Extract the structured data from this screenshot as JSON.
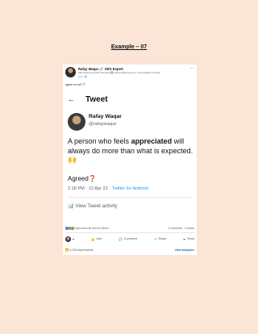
{
  "heading": "Example – 07",
  "post": {
    "author": "Rafay Waqar",
    "role": "SEO Expert",
    "headline": "SEO Expert and PPC Specialist ✅ Helping Businesses to Grow Digitally Through...",
    "time": "1mo · 🌐",
    "caption": "agree or not?",
    "reactions_count": "Syed Anas Ali and 60 others",
    "comments": "9 comments · 4 shares",
    "impressions": "4,218 impressions",
    "analytics_label": "View analytics",
    "actions": [
      "Like",
      "Comment",
      "Share",
      "Send"
    ]
  },
  "tweet": {
    "header_title": "Tweet",
    "name": "Rafay Waqar",
    "handle": "@rafaywaqar",
    "text_before": "A person who feels ",
    "text_bold": "appreciated",
    "text_after": " will always do more than what is expected. 🙌",
    "agreed": "Agreed",
    "question_mark": "❓",
    "meta_time": "2:18 PM · 12 Apr 22 · ",
    "meta_source": "Twitter for Android",
    "activity": "View Tweet activity"
  },
  "colors": {
    "background": "#fbe5d6",
    "link": "#1d9bf0",
    "linkedin_blue": "#0a66c2"
  }
}
